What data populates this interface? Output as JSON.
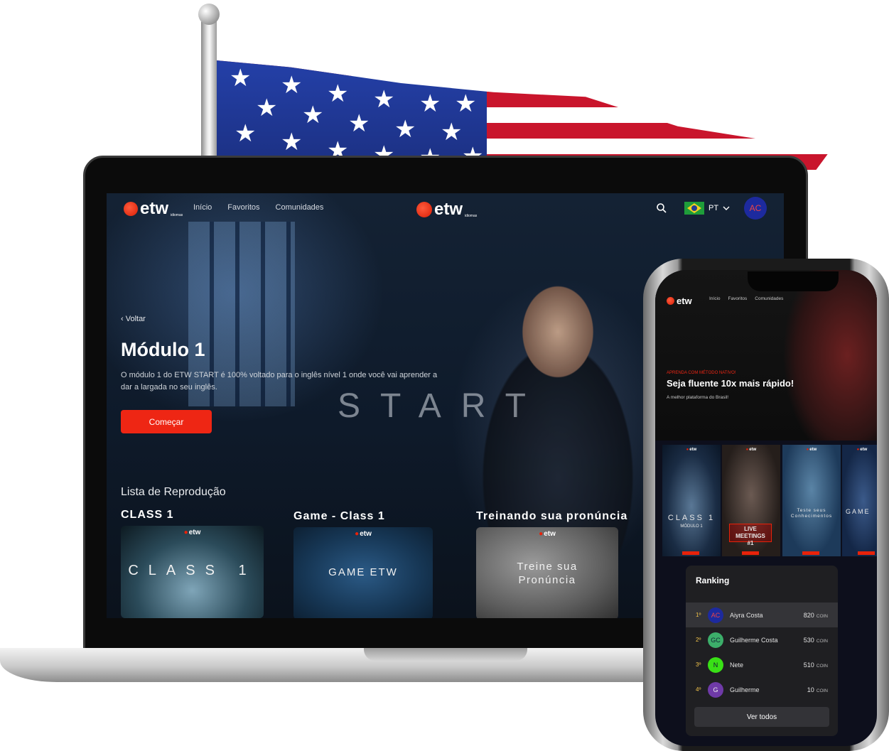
{
  "desktop": {
    "logo": {
      "text": "etw",
      "sub": "idiomas"
    },
    "nav": [
      "Início",
      "Favoritos",
      "Comunidades"
    ],
    "center_logo": {
      "text": "etw",
      "sub": "idiomas"
    },
    "language": {
      "code": "PT"
    },
    "user": {
      "initials": "AC"
    },
    "hero": {
      "back_label": "‹ Voltar",
      "title": "Módulo 1",
      "description": "O módulo 1 do ETW START é 100% voltado para o inglês nível 1 onde você vai aprender a dar a largada no seu inglês.",
      "watermark": "START",
      "cta_label": "Começar"
    },
    "playlist": {
      "title": "Lista de Reprodução",
      "cards": [
        {
          "title": "CLASS 1",
          "thumb_label": "CLASS 1",
          "thumb_logo": "etw"
        },
        {
          "title": "Game - Class 1",
          "thumb_label": "GAME ETW",
          "thumb_logo": "etw"
        },
        {
          "title": "Treinando sua pronúncia",
          "thumb_label": "Treine sua Pronúncia",
          "thumb_logo": "etw"
        }
      ]
    }
  },
  "mobile": {
    "logo": "etw",
    "nav": [
      "Início",
      "Favoritos",
      "Comunidades"
    ],
    "hero": {
      "kicker": "APRENDA COM MÉTODO NATIVO!",
      "headline": "Seja fluente 10x mais rápido!",
      "sub": "A melhor plataforma do Brasil!"
    },
    "cards": [
      {
        "label": "CLASS 1",
        "sub": "MÓDULO 1",
        "logo": "etw"
      },
      {
        "label": "LIVE MEETINGS #1",
        "logo": "etw"
      },
      {
        "label": "Teste seus Conhecimentos",
        "logo": "etw"
      },
      {
        "label": "GAME",
        "logo": "etw"
      }
    ],
    "ranking": {
      "title": "Ranking",
      "rows": [
        {
          "pos": "1º",
          "initials": "AC",
          "name": "Aiyra Costa",
          "coins": "820",
          "unit": "COIN",
          "color": "#1d2a9e",
          "text_color": "#e44"
        },
        {
          "pos": "2º",
          "initials": "GC",
          "name": "Guilherme Costa",
          "coins": "530",
          "unit": "COIN",
          "color": "#3cae6a",
          "text_color": "#123"
        },
        {
          "pos": "3º",
          "initials": "N",
          "name": "Nete",
          "coins": "510",
          "unit": "COIN",
          "color": "#39e016",
          "text_color": "#113"
        },
        {
          "pos": "4º",
          "initials": "G",
          "name": "Guilherme",
          "coins": "10",
          "unit": "COIN",
          "color": "#6f3aa8",
          "text_color": "#eee"
        }
      ],
      "see_all_label": "Ver todos"
    }
  },
  "colors": {
    "accent": "#ee2614",
    "background": "#0d0f1c"
  }
}
